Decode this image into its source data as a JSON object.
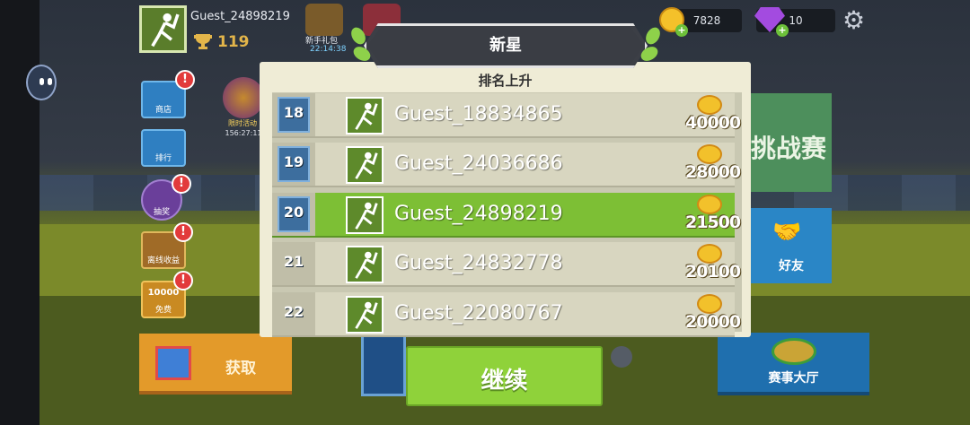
{
  "player": {
    "name": "Guest_24898219",
    "trophies": "119"
  },
  "top_bar": {
    "gift_label": "新手礼包",
    "gift_timer": "22:14:38",
    "coins": "7828",
    "gems": "10"
  },
  "side_menu": {
    "shop": "商店",
    "rank": "排行",
    "lottery": "抽奖",
    "offline": "离线收益",
    "free": "免费",
    "free_amount": "10000",
    "event_label": "限时活动",
    "event_timer": "156:27:11"
  },
  "main_buttons": {
    "challenge": "挑战赛",
    "friends": "好友",
    "hall": "赛事大厅",
    "get": "获取"
  },
  "modal": {
    "title": "新星",
    "subtitle": "排名上升",
    "continue_label": "继续",
    "rows": [
      {
        "rank": "18",
        "name": "Guest_18834865",
        "coins": "40000",
        "highlight": false
      },
      {
        "rank": "19",
        "name": "Guest_24036686",
        "coins": "28000",
        "highlight": false
      },
      {
        "rank": "20",
        "name": "Guest_24898219",
        "coins": "21500",
        "highlight": true
      },
      {
        "rank": "21",
        "name": "Guest_24832778",
        "coins": "20100",
        "highlight": false
      },
      {
        "rank": "22",
        "name": "Guest_22080767",
        "coins": "20000",
        "highlight": false
      }
    ]
  },
  "colors": {
    "highlight_row": "#7dbf35",
    "continue_button": "#8fd23a",
    "panel": "#efecd6"
  }
}
